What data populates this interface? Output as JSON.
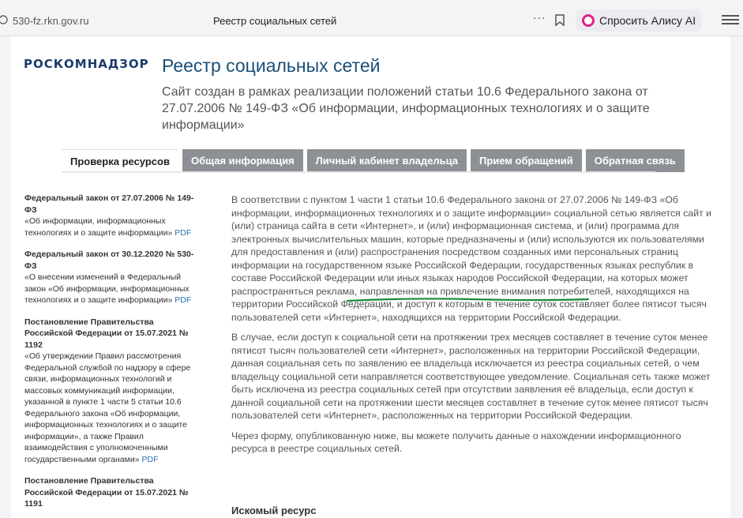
{
  "browser": {
    "url": "530-fz.rkn.gov.ru",
    "tab_title": "Реестр социальных сетей",
    "more_label": "···",
    "assistant_button": "Спросить Алису AI"
  },
  "header": {
    "logo": "РОСКОМНАДЗОР",
    "title": "Реестр социальных сетей",
    "subtitle": "Сайт создан в рамках реализации положений статьи 10.6 Федерального закона от 27.07.2006 № 149-ФЗ «Об информации, информационных технологиях и о защите информации»"
  },
  "tabs": [
    {
      "label": "Проверка ресурсов",
      "active": true
    },
    {
      "label": "Общая информация",
      "active": false
    },
    {
      "label": "Личный кабинет владельца",
      "active": false
    },
    {
      "label": "Прием обращений",
      "active": false
    },
    {
      "label": "Обратная связь",
      "active": false
    }
  ],
  "sidebar": {
    "laws": [
      {
        "title": "Федеральный закон от 27.07.2006 № 149-ФЗ",
        "desc": "«Об информации, информационных технологиях и о защите информации»",
        "link": "PDF"
      },
      {
        "title": "Федеральный закон от 30.12.2020 № 530-ФЗ",
        "desc": "«О внесении изменений в Федеральный закон «Об информации, информационных технологиях и о защите информации»",
        "link": "PDF"
      },
      {
        "title": "Постановление Правительства Российской Федерации от 15.07.2021 № 1192",
        "desc": "«Об утверждении Правил рассмотрения Федеральной службой по надзору в сфере связи, информационных технологий и массовых коммуникаций информации, указанной в пункте 1 части 5 статьи 10.6 Федерального закона «Об информации, информационных технологиях и о защите информации», а также Правил взаимодействия с уполномоченными государственными органами»",
        "link": "PDF"
      },
      {
        "title": "Постановление Правительства Российской Федерации от 15.07.2021 № 1191",
        "desc": "",
        "link": ""
      }
    ]
  },
  "main": {
    "paragraphs": [
      "В соответствии с пунктом 1 части 1 статьи 10.6 Федерального закона от 27.07.2006 № 149-ФЗ «Об информации, информационных технологиях и о защите информации» социальной сетью является сайт и (или) страница сайта в сети «Интернет», и (или) информационная система, и (или) программа для электронных вычислительных машин, которые предназначены и (или) используются их пользователями для предоставления и (или) распространения посредством созданных ими персональных страниц информации на государственном языке Российской Федерации, государственных языках республик в составе Российской Федерации или иных языках народов Российской Федерации, на которых может распространяться реклама, направленная на привлечение внимания потребителей, находящихся на территории Российской Федерации, и доступ к которым в течение суток составляет более пятисот тысяч пользователей сети «Интернет», находящихся на территории Российской Федерации.",
      "В случае, если доступ к социальной сети на протяжении трех месяцев составляет в течение суток менее пятисот тысяч пользователей сети «Интернет», расположенных на территории Российской Федерации, данная социальная сеть по заявлению ее владельца исключается из реестра социальных сетей, о чем владельцу социальной сети направляется соответствующее уведомление. Социальная сеть также может быть исключена из реестра социальных сетей при отсутствии заявления её владельца, если доступ к данной социальной сети на протяжении шести месяцев составляет в течение суток менее пятисот тысяч пользователей сети «Интернет», расположенных на территории Российской Федерации.",
      "Через форму, опубликованную ниже, вы можете получить данные о нахождении информационного ресурса в реестре социальных сетей."
    ],
    "search_heading": "Искомый ресурс"
  },
  "colors": {
    "title_blue": "#1b4f77",
    "logo_blue": "#1b3c6b",
    "tab_gray": "#8d9094",
    "link_blue": "#2a6fb7",
    "underline_green": "#1a8a3a",
    "alisa_pink": "#e0218a"
  }
}
